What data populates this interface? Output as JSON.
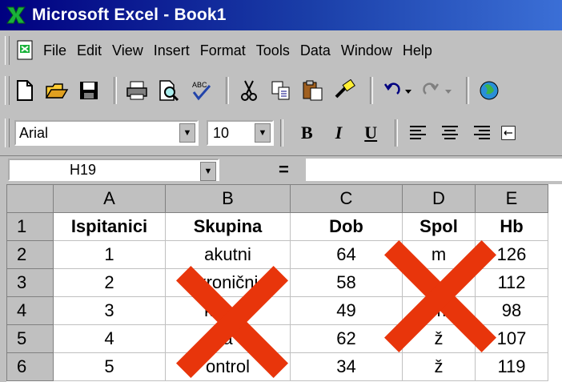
{
  "window": {
    "title": "Microsoft Excel - Book1",
    "accent": "#000080"
  },
  "menu": {
    "items": [
      "File",
      "Edit",
      "View",
      "Insert",
      "Format",
      "Tools",
      "Data",
      "Window",
      "Help"
    ]
  },
  "toolbar_standard": {
    "icons": [
      "new-icon",
      "open-icon",
      "save-icon",
      "print-icon",
      "print-preview-icon",
      "spelling-icon",
      "cut-icon",
      "copy-icon",
      "paste-icon",
      "format-painter-icon",
      "undo-icon",
      "redo-icon",
      "web-icon"
    ]
  },
  "toolbar_formatting": {
    "font": "Arial",
    "size": "10",
    "bold": "B",
    "italic": "I",
    "underline": "U"
  },
  "formula_bar": {
    "name_box": "H19",
    "equals": "=",
    "value": ""
  },
  "sheet": {
    "columns": [
      "A",
      "B",
      "C",
      "D",
      "E"
    ],
    "rows": [
      {
        "num": "1",
        "cells": [
          "Ispitanici",
          "Skupina",
          "Dob",
          "Spol",
          "Hb"
        ]
      },
      {
        "num": "2",
        "cells": [
          "1",
          "akutni",
          "64",
          "m",
          "126"
        ]
      },
      {
        "num": "3",
        "cells": [
          "2",
          "kronični",
          "58",
          "",
          "112"
        ]
      },
      {
        "num": "4",
        "cells": [
          "3",
          "kronič",
          "49",
          "m",
          "98"
        ]
      },
      {
        "num": "5",
        "cells": [
          "4",
          "a",
          "62",
          "ž",
          "107"
        ]
      },
      {
        "num": "6",
        "cells": [
          "5",
          "ontrol",
          "34",
          "ž",
          "119"
        ]
      }
    ]
  },
  "overlay": {
    "mark_color": "#e8350b"
  }
}
